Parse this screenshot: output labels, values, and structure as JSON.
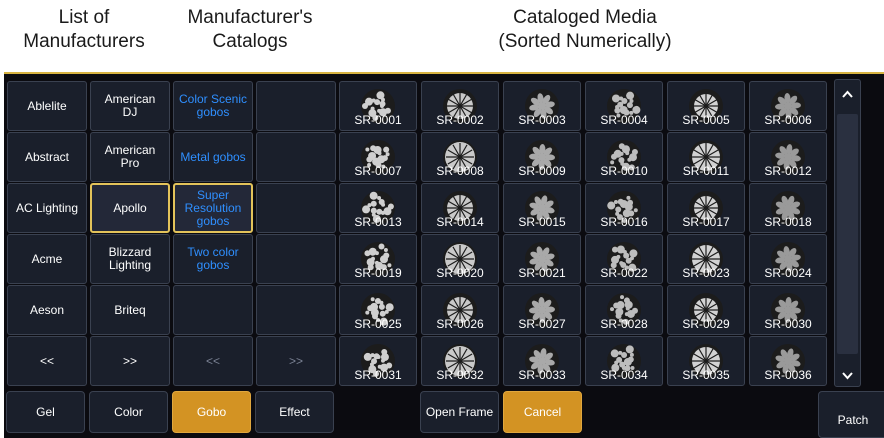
{
  "headers": {
    "manufacturers": [
      "List of",
      "Manufacturers"
    ],
    "catalogs": [
      "Manufacturer's",
      "Catalogs"
    ],
    "media": [
      "Cataloged Media",
      "(Sorted Numerically)"
    ]
  },
  "manufacturers": [
    "Ablelite",
    "Abstract",
    "AC Lighting",
    "Acme",
    "Aeson",
    "<<"
  ],
  "catalog_manufacturers": [
    [
      "American",
      "DJ"
    ],
    [
      "American",
      "Pro"
    ],
    [
      "Apollo"
    ],
    [
      "Blizzard",
      "Lighting"
    ],
    [
      "Briteq"
    ],
    [
      ">>"
    ]
  ],
  "catalogs": [
    [
      "Color Scenic",
      "gobos"
    ],
    [
      "Metal gobos"
    ],
    [
      "Super",
      "Resolution",
      "gobos"
    ],
    [
      "Two color",
      "gobos"
    ],
    [],
    [
      "<<"
    ]
  ],
  "col4": [
    "",
    "",
    "",
    "",
    "",
    ">>"
  ],
  "selected": {
    "manufacturer": "Apollo",
    "catalog": "Super Resolution gobos"
  },
  "gobos": [
    "SR-0001",
    "SR-0002",
    "SR-0003",
    "SR-0004",
    "SR-0005",
    "SR-0006",
    "SR-0007",
    "SR-0008",
    "SR-0009",
    "SR-0010",
    "SR-0011",
    "SR-0012",
    "SR-0013",
    "SR-0014",
    "SR-0015",
    "SR-0016",
    "SR-0017",
    "SR-0018",
    "SR-0019",
    "SR-0020",
    "SR-0021",
    "SR-0022",
    "SR-0023",
    "SR-0024",
    "SR-0025",
    "SR-0026",
    "SR-0027",
    "SR-0028",
    "SR-0029",
    "SR-0030",
    "SR-0031",
    "SR-0032",
    "SR-0033",
    "SR-0034",
    "SR-0035",
    "SR-0036"
  ],
  "bottom_buttons": {
    "gel": "Gel",
    "color": "Color",
    "gobo": "Gobo",
    "effect": "Effect",
    "open_frame": "Open Frame",
    "cancel": "Cancel",
    "patch": "Patch"
  },
  "scroll": {
    "up_icon": "chevron-up-icon",
    "down_icon": "chevron-down-icon"
  },
  "colors": {
    "accent": "#d39323",
    "selection_border": "#e3c35a",
    "link_blue": "#2f8fff",
    "panel": "#0b0b10",
    "button": "#1a1f2b"
  }
}
